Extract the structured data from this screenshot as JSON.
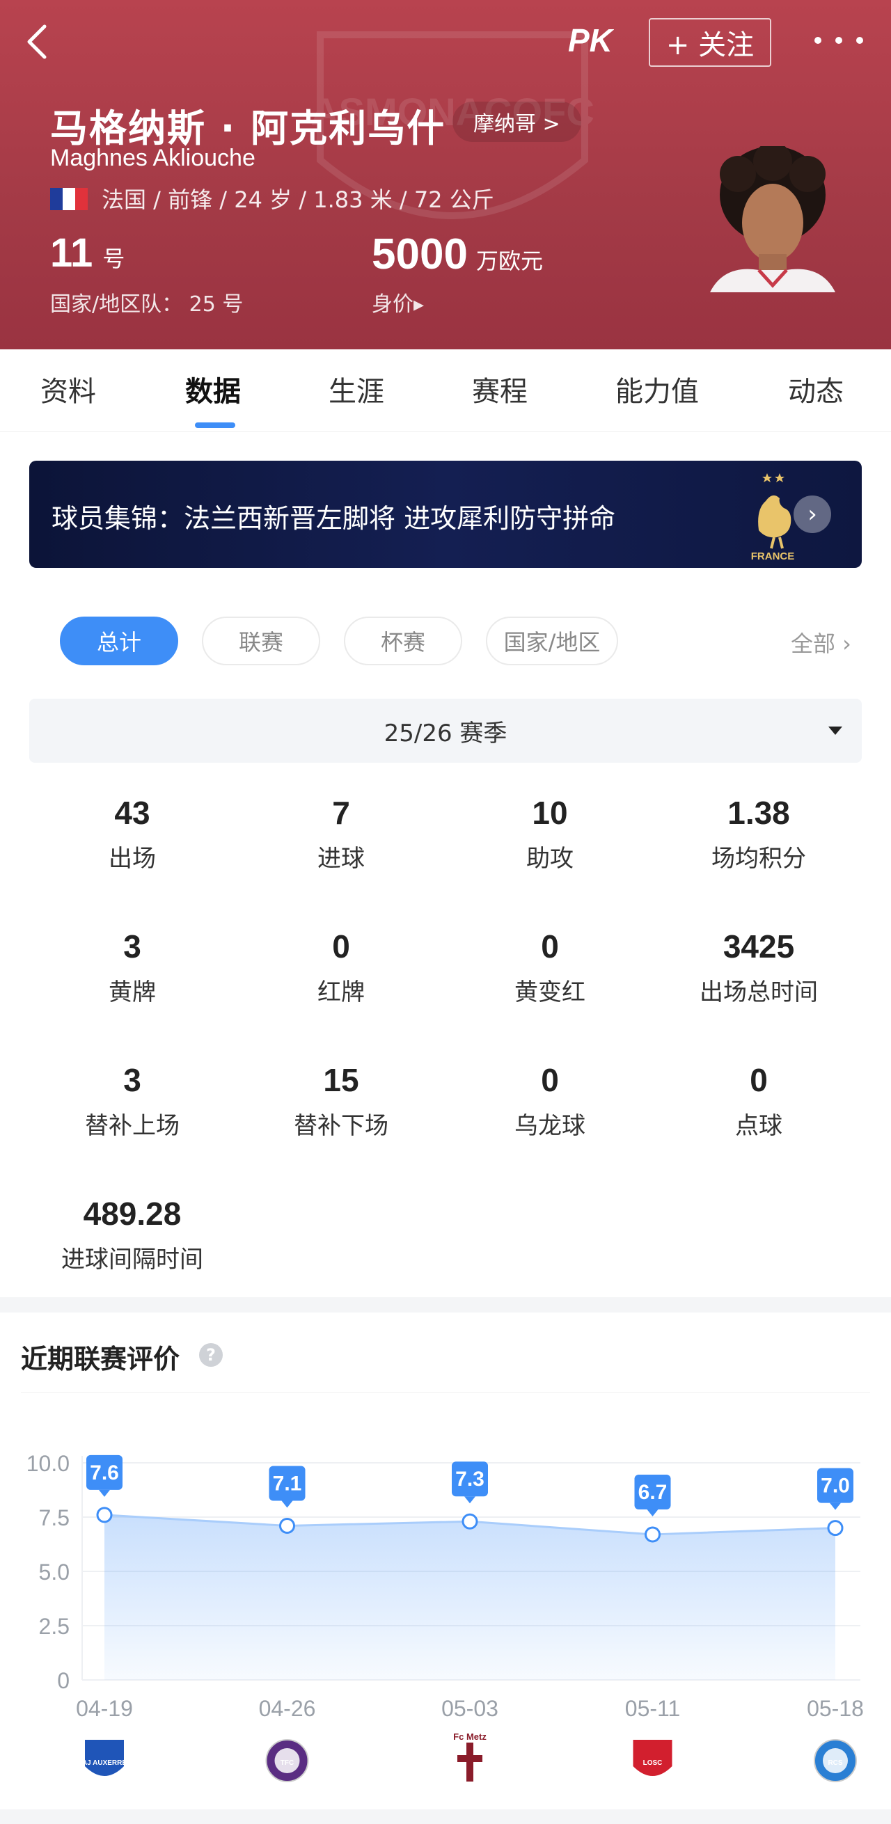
{
  "header": {
    "follow_label": "+ 关注",
    "name_cn": "马格纳斯 · 阿克利乌什",
    "name_en": "Maghnes Akliouche",
    "club_link": "摩纳哥 >",
    "info_line": "法国 / 前锋 / 24 岁 / 1.83 米 / 72 公斤",
    "shirt_number": "11",
    "shirt_unit": "号",
    "national_number": "国家/地区队：  25 号",
    "market_value": "5000",
    "value_unit": "万欧元",
    "value_label": "身价▸",
    "watermark_text": "ASMONACOFC",
    "flag_colors": [
      "#1f3c9b",
      "#ffffff",
      "#e1323b"
    ]
  },
  "tabs": [
    "资料",
    "数据",
    "生涯",
    "赛程",
    "能力值",
    "动态"
  ],
  "active_tab": "数据",
  "banner": {
    "text": "球员集锦：法兰西新晋左脚将 进攻犀利防守拼命",
    "crest_text": "FRANCE"
  },
  "filters": {
    "chips": [
      "总计",
      "联赛",
      "杯赛",
      "国家/地区"
    ],
    "active": "总计",
    "all_label": "全部 ›"
  },
  "season": "25/26 赛季",
  "stats": [
    {
      "value": "43",
      "label": "出场"
    },
    {
      "value": "7",
      "label": "进球"
    },
    {
      "value": "10",
      "label": "助攻"
    },
    {
      "value": "1.38",
      "label": "场均积分"
    },
    {
      "value": "3",
      "label": "黄牌"
    },
    {
      "value": "0",
      "label": "红牌"
    },
    {
      "value": "0",
      "label": "黄变红"
    },
    {
      "value": "3425",
      "label": "出场总时间"
    },
    {
      "value": "3",
      "label": "替补上场"
    },
    {
      "value": "15",
      "label": "替补下场"
    },
    {
      "value": "0",
      "label": "乌龙球"
    },
    {
      "value": "0",
      "label": "点球"
    },
    {
      "value": "489.28",
      "label": "进球间隔时间"
    }
  ],
  "rating": {
    "title": "近期联赛评价",
    "help_icon": "?"
  },
  "chart_data": {
    "type": "area",
    "x": [
      "04-19",
      "04-26",
      "05-03",
      "05-11",
      "05-18"
    ],
    "values": [
      7.6,
      7.1,
      7.3,
      6.7,
      7.0
    ],
    "value_labels": [
      "7.6",
      "7.1",
      "7.3",
      "6.7",
      "7.0"
    ],
    "yticks": [
      "10.0",
      "7.5",
      "5.0",
      "2.5",
      "0"
    ],
    "ylim": [
      0,
      10
    ],
    "grid": true,
    "color": "#3e8ef7",
    "opponent_logos": [
      "auxerre",
      "toulouse",
      "metz",
      "lille",
      "strasbourg"
    ],
    "opponent_logo_texts": [
      "AJ AUXERRE",
      "TFC",
      "Fc Metz",
      "LOSC",
      "RCS"
    ]
  }
}
